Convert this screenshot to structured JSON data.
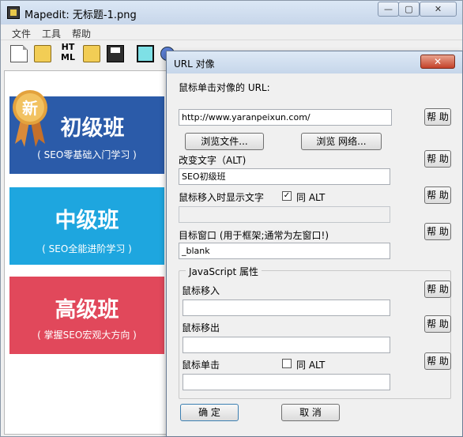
{
  "window": {
    "title": "Mapedit: 无标题-1.png",
    "minimize_glyph": "—",
    "maximize_glyph": "▢",
    "close_glyph": "✕"
  },
  "menu": [
    "文件",
    "工具",
    "帮助"
  ],
  "toolbar": {
    "html_label": "HT\nML",
    "icons": [
      "new-file-icon",
      "open-folder-icon",
      "html-icon",
      "open-image-icon",
      "save-icon",
      "rectangle-tool-icon",
      "circle-tool-icon"
    ]
  },
  "canvas": {
    "badge": "新",
    "courses": [
      {
        "title": "初级班",
        "subtitle": "( SEO零基础入门学习 )"
      },
      {
        "title": "中级班",
        "subtitle": "( SEO全能进阶学习 )"
      },
      {
        "title": "高级班",
        "subtitle": "( 掌握SEO宏观大方向 )"
      }
    ]
  },
  "dialog": {
    "title": "URL 对像",
    "close_glyph": "✕",
    "url_label": "鼠标单击对像的 URL:",
    "url_value": "http://www.yaranpeixun.com/",
    "help_label": "帮 助",
    "browse_file": "浏览文件...",
    "browse_web": "浏览 网络...",
    "alt_label": "改变文字（ALT)",
    "alt_value": "SEO初级班",
    "hover_label": "鼠标移入时显示文字",
    "same_alt": "同 ALT",
    "checked_glyph": "✓",
    "target_label": "目标窗口 (用于框架;通常为左窗口!)",
    "target_value": "_blank",
    "js_group": "JavaScript 属性",
    "mouseover_label": "鼠标移入",
    "mouseout_label": "鼠标移出",
    "click_label": "鼠标单击",
    "ok": "确 定",
    "cancel": "取 消"
  }
}
